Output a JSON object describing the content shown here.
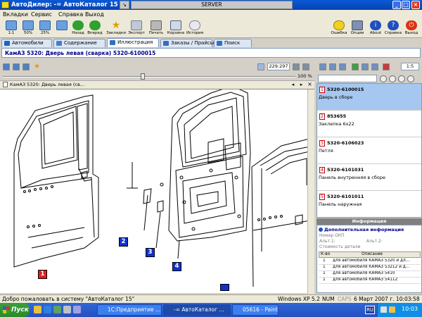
{
  "window": {
    "title": "АвтоДилер: -= АвтоКаталог 15",
    "server_tab": "SERVER"
  },
  "menu": [
    "Вкладки",
    "Сервис",
    "Справка",
    "Выход"
  ],
  "toolbar": {
    "items": [
      {
        "label": "1:1",
        "icon": "zoom-1-1-icon"
      },
      {
        "label": "50%",
        "icon": "zoom-50-icon"
      },
      {
        "label": "25%",
        "icon": "zoom-25-icon"
      },
      {
        "label": "",
        "icon": "zoom-fit-icon"
      },
      {
        "label": "Назад",
        "icon": "back-icon"
      },
      {
        "label": "Вперед",
        "icon": "forward-icon"
      },
      {
        "label": "Закладки",
        "icon": "bookmarks-icon"
      },
      {
        "label": "Экспорт",
        "icon": "export-icon"
      },
      {
        "label": "Печать",
        "icon": "print-icon"
      },
      {
        "label": "Корзина",
        "icon": "cart-icon"
      },
      {
        "label": "История",
        "icon": "history-icon"
      }
    ],
    "right_items": [
      {
        "label": "Ошибка",
        "icon": "error-smiley-icon"
      },
      {
        "label": "Опции",
        "icon": "options-icon"
      },
      {
        "label": "About",
        "icon": "about-icon"
      },
      {
        "label": "Справка",
        "icon": "help-icon"
      },
      {
        "label": "Выход",
        "icon": "exit-icon"
      }
    ]
  },
  "tabs": [
    {
      "label": "Автомобили",
      "active": false
    },
    {
      "label": "Содержание",
      "active": false
    },
    {
      "label": "Иллюстрация",
      "active": true
    },
    {
      "label": "Заказы / Прайсы",
      "active": false
    },
    {
      "label": "Поиск",
      "active": false
    }
  ],
  "breadcrumb": "КамАЗ 5320: Дверь левая (сварка) 5320-6100015",
  "viewer": {
    "coords": "229:297",
    "zoom": "100 %",
    "doc_tab": "КамАЗ 5320: Дверь левая (св..."
  },
  "callouts": [
    {
      "n": "1",
      "color": "#e02020"
    },
    {
      "n": "2",
      "color": "#1030d0"
    },
    {
      "n": "3",
      "color": "#1030d0"
    },
    {
      "n": "4",
      "color": "#1030d0"
    }
  ],
  "right_toolbar": {
    "scale": "1:5"
  },
  "parts": [
    {
      "n": "1",
      "code": "5320-6100015",
      "name": "Дверь в сборе",
      "selected": true
    },
    {
      "n": "2",
      "code": "853655",
      "name": "Заклепка 6х22",
      "selected": false
    },
    {
      "n": "3",
      "code": "5320-6106023",
      "name": "Петля",
      "selected": false
    },
    {
      "n": "4",
      "code": "5320-6101031",
      "name": "Панель внутренняя в сборе",
      "selected": false
    },
    {
      "n": "5",
      "code": "5320-6101011",
      "name": "Панель наружная",
      "selected": false
    }
  ],
  "info": {
    "header": "Информация",
    "title": "Дополнительная информация",
    "oem_label": "Номер ОКП",
    "alt1_label": "Альт.1:",
    "alt2_label": "Альт.2:",
    "cost_label": "Стоимость детали",
    "table_headers": [
      "К-во",
      "Описание"
    ],
    "rows": [
      {
        "qty": "1",
        "desc": "для автомобиля КАМАЗ 5320 и дл..."
      },
      {
        "qty": "1",
        "desc": "для автомобиля КАМАЗ 53212 и д..."
      },
      {
        "qty": "1",
        "desc": "для автомобиля КАМАЗ 5410"
      },
      {
        "qty": "1",
        "desc": "для автомобиля КАМАЗ 54112"
      }
    ]
  },
  "status": {
    "message": "Добро пожаловать в систему \"АвтоКаталог 15\"",
    "os": "Windows XP 5.2",
    "num": "NUM",
    "caps": "CAPS",
    "datetime": "6 Март 2007 г.  10:03:58"
  },
  "taskbar": {
    "start": "Пуск",
    "buttons": [
      {
        "label": "1С:Предприятие ...",
        "active": false
      },
      {
        "label": "-= АвтоКаталог ...",
        "active": true
      },
      {
        "label": "05616 - Paint",
        "active": false
      }
    ],
    "lang": "RU",
    "clock": "10:03"
  }
}
